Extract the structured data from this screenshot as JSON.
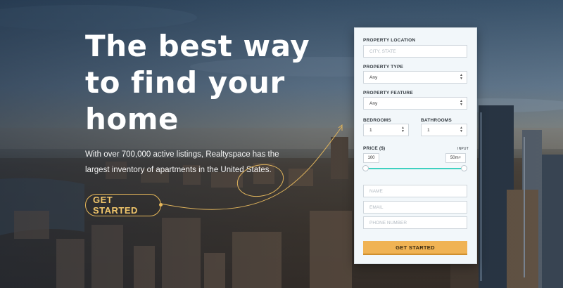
{
  "hero": {
    "headline_lines": [
      "The best way",
      "to find your",
      "home"
    ],
    "subtext": "With over 700,000 active listings, Realtyspace has the largest inventory of apartments in the United States.",
    "cta_label": "GET STARTED"
  },
  "form": {
    "location": {
      "label": "PROPERTY LOCATION",
      "placeholder": "CITY, STATE"
    },
    "type": {
      "label": "PROPERTY TYPE",
      "value": "Any"
    },
    "feature": {
      "label": "PROPERTY FEATURE",
      "value": "Any"
    },
    "bedrooms": {
      "label": "BEDROOMS",
      "value": "1"
    },
    "bathrooms": {
      "label": "BATHROOMS",
      "value": "1"
    },
    "price": {
      "label": "PRICE ($)",
      "mode_label": "INPUT",
      "min": "100",
      "max": "50m+"
    },
    "name": {
      "placeholder": "NAME"
    },
    "email": {
      "placeholder": "EMAIL"
    },
    "phone": {
      "placeholder": "PHONE NUMBER"
    },
    "submit_label": "GET STARTED"
  },
  "colors": {
    "accent": "#f0b354",
    "slider": "#3fd1c0",
    "cta_outline": "#e8b95a"
  }
}
